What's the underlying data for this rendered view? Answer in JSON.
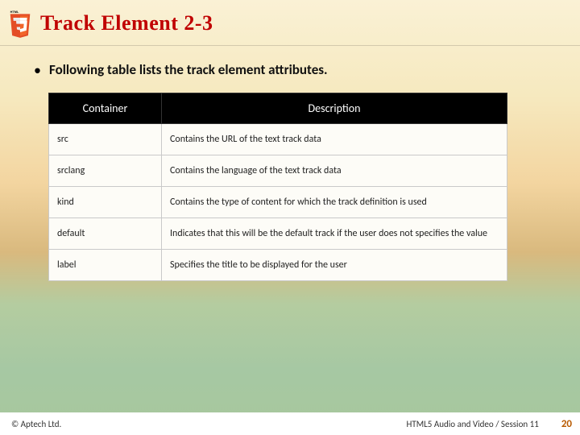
{
  "header": {
    "title": "Track Element 2-3"
  },
  "lead_text": "Following table lists the track element attributes.",
  "table": {
    "headers": {
      "col1": "Container",
      "col2": "Description"
    },
    "rows": [
      {
        "attr": "src",
        "desc": "Contains the URL of the text track data"
      },
      {
        "attr": "srclang",
        "desc": "Contains the language of the text track data"
      },
      {
        "attr": "kind",
        "desc": "Contains the type of content for which the track definition is used"
      },
      {
        "attr": "default",
        "desc": "Indicates that this will be the default track if the user does not specifies the value"
      },
      {
        "attr": "label",
        "desc": "Specifies the title to be displayed for the user"
      }
    ]
  },
  "footer": {
    "copyright": "© Aptech Ltd.",
    "session": "HTML5 Audio and Video / Session 11",
    "page": "20"
  }
}
